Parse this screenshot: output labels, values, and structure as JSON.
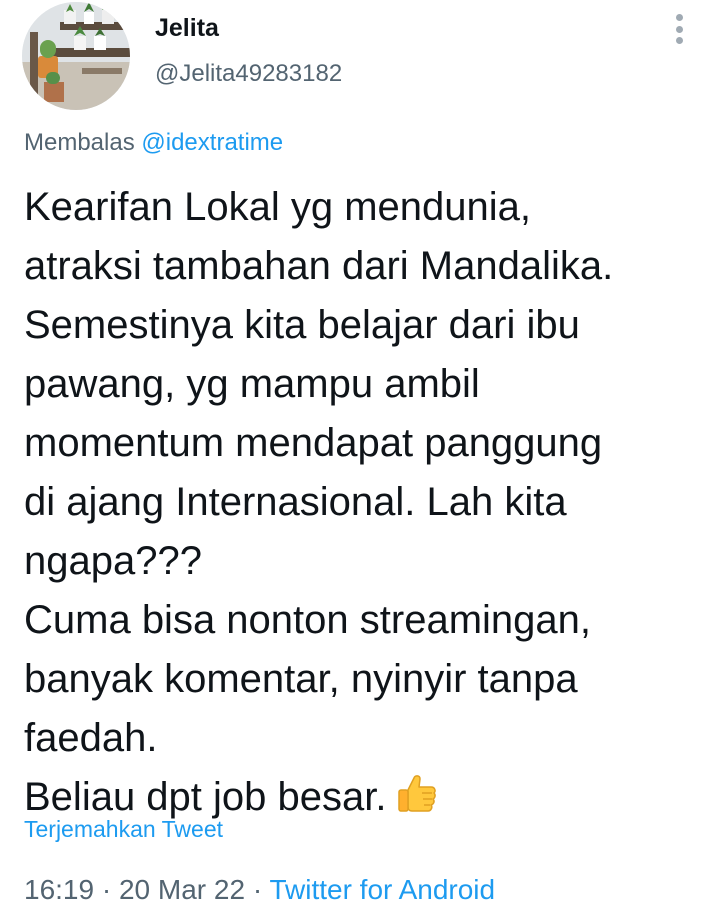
{
  "user": {
    "display_name": "Jelita",
    "handle": "@Jelita49283182",
    "avatar_icon": "avatar-plants-photo"
  },
  "menu": {
    "icon": "more-vertical-icon"
  },
  "reply": {
    "prefix": "Membalas",
    "mention": "@idextratime"
  },
  "tweet": {
    "lines": [
      "Kearifan Lokal yg mendunia,",
      "atraksi tambahan dari Mandalika.",
      "Semestinya kita belajar dari ibu",
      "pawang, yg mampu ambil",
      "momentum mendapat panggung",
      "di ajang Internasional. Lah kita",
      "ngapa???",
      "Cuma bisa nonton streamingan,",
      "banyak komentar, nyinyir tanpa",
      "faedah.",
      "Beliau dpt job besar."
    ],
    "emoji": "thumbs-up-emoji"
  },
  "translate_label": "Terjemahkan Tweet",
  "meta": {
    "time": "16:19",
    "separator": "·",
    "date": "20 Mar 22",
    "source": "Twitter for Android"
  },
  "colors": {
    "link": "#1d9bf0",
    "secondary_text": "#536471",
    "primary_text": "#0f1419"
  }
}
